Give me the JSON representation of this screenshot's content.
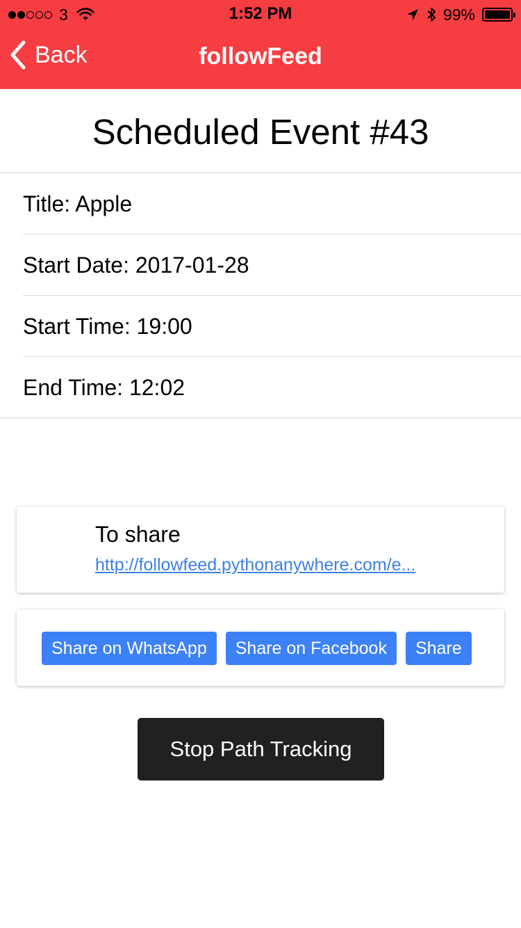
{
  "status_bar": {
    "carrier": "3",
    "signal_bars_filled": 2,
    "signal_bars_total": 5,
    "time": "1:52 PM",
    "battery_percent": "99%",
    "battery_level": 0.99
  },
  "nav": {
    "back_label": "Back",
    "title": "followFeed"
  },
  "page_title": "Scheduled Event #43",
  "details": [
    {
      "label": "Title: Apple"
    },
    {
      "label": "Start Date: 2017-01-28"
    },
    {
      "label": "Start Time: 19:00"
    },
    {
      "label": "End Time: 12:02"
    }
  ],
  "share": {
    "label": "To share",
    "link": "http://followfeed.pythonanywhere.com/e..."
  },
  "share_buttons": [
    {
      "label": "Share on WhatsApp"
    },
    {
      "label": "Share on Facebook"
    },
    {
      "label": "Share"
    }
  ],
  "stop_button_label": "Stop Path Tracking",
  "colors": {
    "header": "#f63d41",
    "share_button": "#3c82f6",
    "link": "#3d7fe6",
    "stop_button": "#212121"
  }
}
